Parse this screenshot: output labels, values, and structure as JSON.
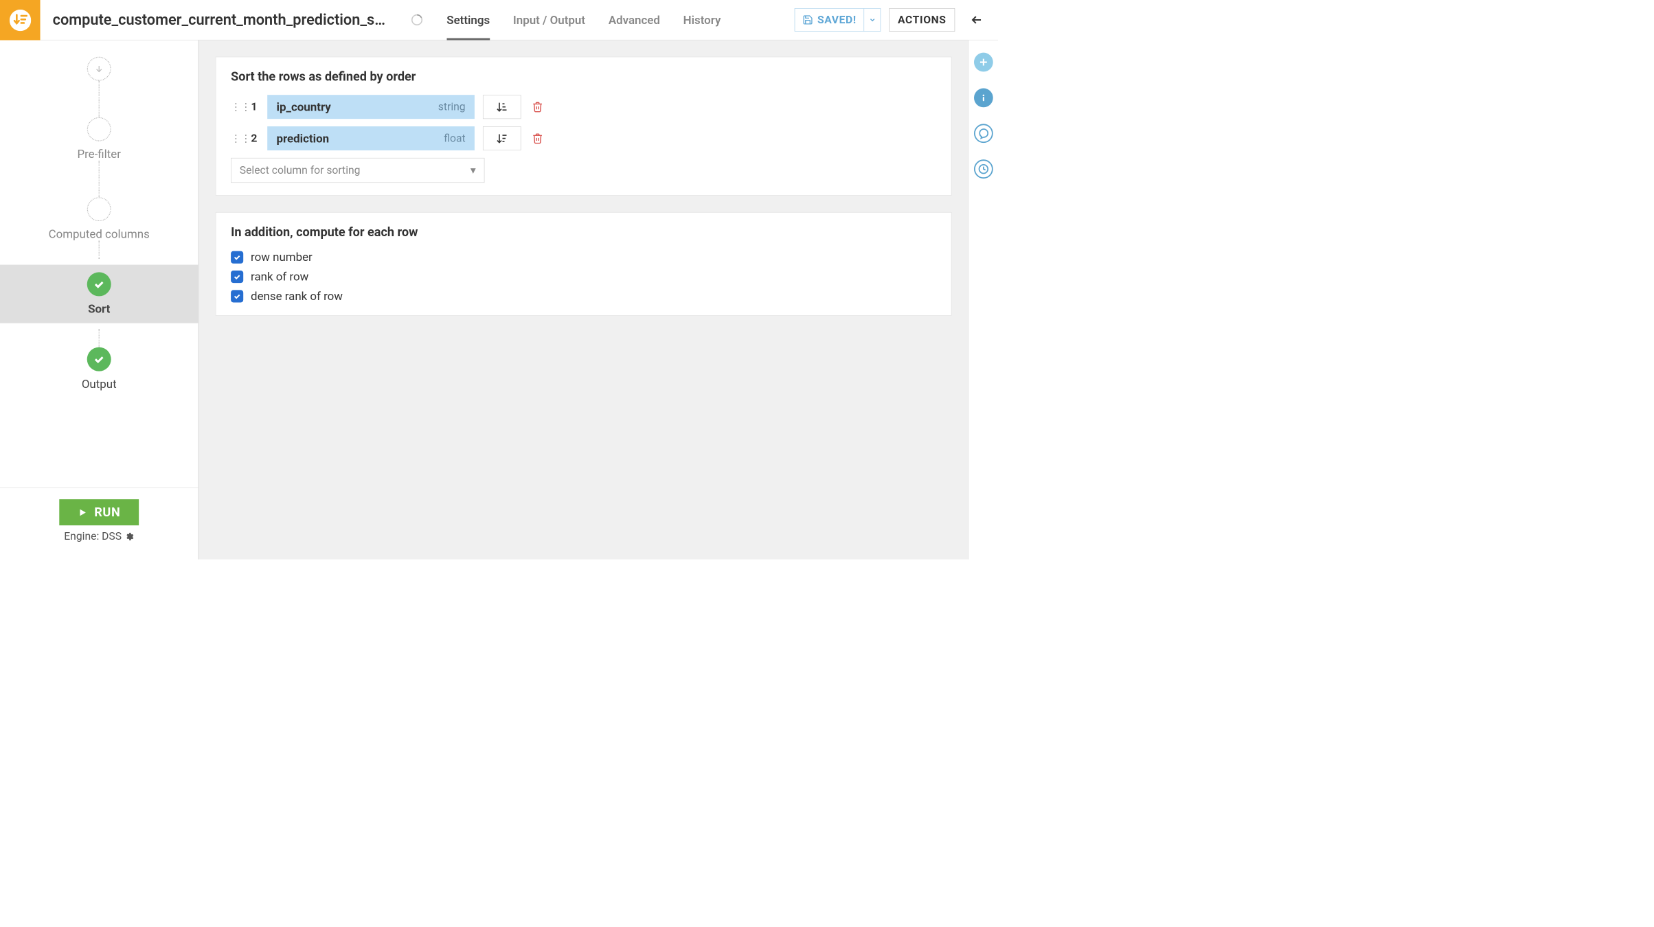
{
  "header": {
    "title": "compute_customer_current_month_prediction_s…",
    "tabs": [
      "Settings",
      "Input / Output",
      "Advanced",
      "History"
    ],
    "active_tab_index": 0,
    "saved_label": "SAVED!",
    "actions_label": "ACTIONS"
  },
  "sidebar": {
    "steps": [
      {
        "id": "input",
        "label": "",
        "kind": "input"
      },
      {
        "id": "prefilter",
        "label": "Pre-filter",
        "kind": "dotted"
      },
      {
        "id": "computed",
        "label": "Computed columns",
        "kind": "dotted"
      },
      {
        "id": "sort",
        "label": "Sort",
        "kind": "done",
        "selected": true
      },
      {
        "id": "output",
        "label": "Output",
        "kind": "done"
      }
    ],
    "run_label": "RUN",
    "engine_label": "Engine: DSS"
  },
  "sort_panel": {
    "title": "Sort the rows as defined by order",
    "rows": [
      {
        "index": "1",
        "column": "ip_country",
        "type": "string",
        "direction": "asc"
      },
      {
        "index": "2",
        "column": "prediction",
        "type": "float",
        "direction": "desc"
      }
    ],
    "select_placeholder": "Select column for sorting"
  },
  "compute_panel": {
    "title": "In addition, compute for each row",
    "options": [
      {
        "label": "row number",
        "checked": true
      },
      {
        "label": "rank of row",
        "checked": true
      },
      {
        "label": "dense rank of row",
        "checked": true
      }
    ]
  }
}
